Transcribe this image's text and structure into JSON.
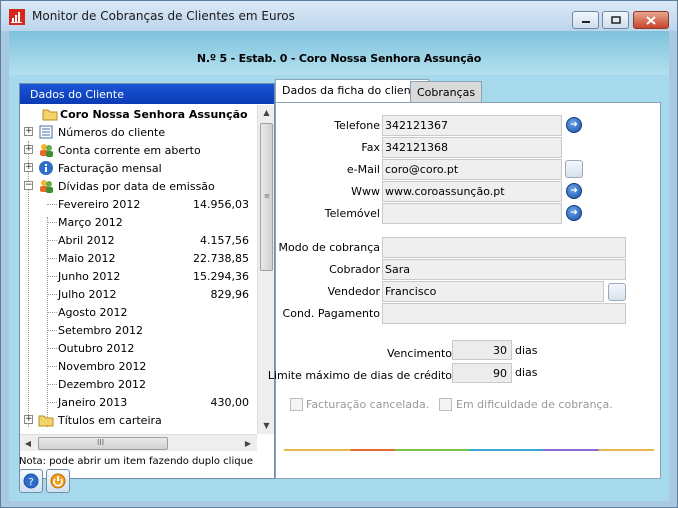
{
  "window": {
    "title": "Monitor de Cobranças de Clientes em Euros"
  },
  "header": {
    "text": "N.º 5 - Estab. 0 - Coro Nossa Senhora Assunção"
  },
  "left_panel": {
    "title": "Dados do Cliente",
    "tree": {
      "root": "Coro Nossa Senhora Assunção",
      "items": [
        {
          "label": "Números do cliente",
          "icon": "list-icon"
        },
        {
          "label": "Conta corrente em aberto",
          "icon": "people-icon"
        },
        {
          "label": "Facturação mensal",
          "icon": "info-icon"
        },
        {
          "label": "Dívidas por data de emissão",
          "icon": "people-icon"
        }
      ],
      "debts": [
        {
          "month": "Fevereiro 2012",
          "value": "14.956,03"
        },
        {
          "month": "Março 2012",
          "value": ""
        },
        {
          "month": "Abril 2012",
          "value": "4.157,56"
        },
        {
          "month": "Maio 2012",
          "value": "22.738,85"
        },
        {
          "month": "Junho 2012",
          "value": "15.294,36"
        },
        {
          "month": "Julho 2012",
          "value": "829,96"
        },
        {
          "month": "Agosto 2012",
          "value": ""
        },
        {
          "month": "Setembro 2012",
          "value": ""
        },
        {
          "month": "Outubro 2012",
          "value": ""
        },
        {
          "month": "Novembro 2012",
          "value": ""
        },
        {
          "month": "Dezembro 2012",
          "value": ""
        },
        {
          "month": "Janeiro 2013",
          "value": "430,00"
        }
      ],
      "last_item": "Títulos em carteira"
    }
  },
  "tabs": [
    {
      "label": "Dados da ficha do cliente",
      "active": true
    },
    {
      "label": "Cobranças",
      "active": false
    }
  ],
  "form": {
    "telefone_label": "Telefone",
    "telefone": "342121367",
    "fax_label": "Fax",
    "fax": "342121368",
    "email_label": "e-Mail",
    "email": "coro@coro.pt",
    "www_label": "Www",
    "www": "www.coroassunção.pt",
    "telemovel_label": "Telemóvel",
    "telemovel": "",
    "modo_label": "Modo de cobrança",
    "modo": "",
    "cobrador_label": "Cobrador",
    "cobrador": "Sara",
    "vendedor_label": "Vendedor",
    "vendedor": "Francisco",
    "cond_label": "Cond. Pagamento",
    "cond": "",
    "vencimento_label": "Vencimento",
    "vencimento": "30",
    "limite_label": "Limite máximo de dias de crédito",
    "limite": "90",
    "dias_label": "dias",
    "facturacao_cancelada": "Facturação cancelada.",
    "dificuldade_cobranca": "Em dificuldade de cobrança."
  },
  "footer": {
    "note": "Nota: pode abrir um item fazendo duplo clique"
  },
  "colors": {
    "title_band": "#1a55d6",
    "client_bg": "#a6d9ec"
  }
}
